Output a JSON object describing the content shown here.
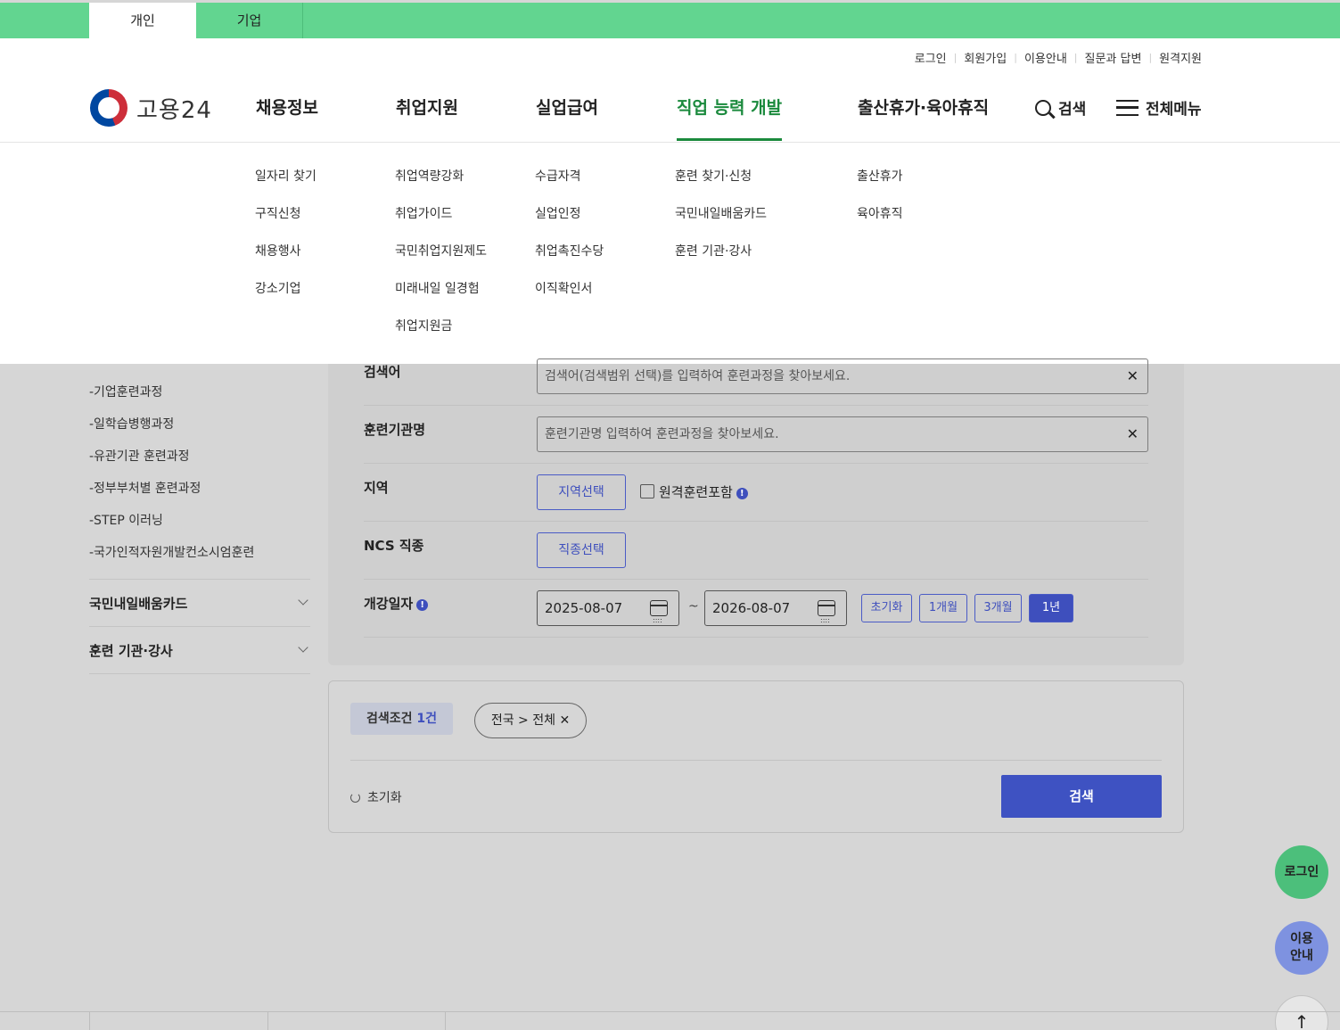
{
  "top_tabs": {
    "personal": "개인",
    "business": "기업"
  },
  "util_menu": [
    "로그인",
    "회원가입",
    "이용안내",
    "질문과 답변",
    "원격지원"
  ],
  "logo": {
    "text": "고용24"
  },
  "gnb": [
    "채용정보",
    "취업지원",
    "실업급여",
    "직업 능력 개발",
    "출산휴가·육아휴직"
  ],
  "header_search": "검색",
  "header_menu": "전체메뉴",
  "submenu": {
    "col1": [
      "일자리 찾기",
      "구직신청",
      "채용행사",
      "강소기업"
    ],
    "col2": [
      "취업역량강화",
      "취업가이드",
      "국민취업지원제도",
      "미래내일 일경험",
      "취업지원금"
    ],
    "col3": [
      "수급자격",
      "실업인정",
      "취업촉진수당",
      "이직확인서"
    ],
    "col4": [
      "훈련 찾기·신청",
      "국민내일배움카드",
      "훈련 기관·강사"
    ],
    "col5": [
      "출산휴가",
      "육아휴직"
    ]
  },
  "sidebar": {
    "subitems": [
      "-기업훈련과정",
      "-일학습병행과정",
      "-유관기관 훈련과정",
      "-정부부처별 훈련과정",
      "-STEP 이러닝",
      "-국가인적자원개발컨소시엄훈련"
    ],
    "sections": [
      "국민내일배움카드",
      "훈련 기관·강사"
    ]
  },
  "form": {
    "keyword_label": "검색어",
    "keyword_placeholder": "검색어(검색범위 선택)를 입력하여 훈련과정을 찾아보세요.",
    "institute_label": "훈련기관명",
    "institute_placeholder": "훈련기관명 입력하여 훈련과정을 찾아보세요.",
    "region_label": "지역",
    "region_button": "지역선택",
    "remote_label": "원격훈련포함",
    "ncs_label": "NCS 직종",
    "ncs_button": "직종선택",
    "date_label": "개강일자",
    "start_date": "2025-08-07",
    "end_date": "2026-08-07",
    "tilde": "~",
    "period_buttons": [
      "초기화",
      "1개월",
      "3개월",
      "1년"
    ]
  },
  "result": {
    "cond_label": "검색조건",
    "cond_count": "1건",
    "chip": "전국 > 전체",
    "reset": "초기화",
    "search": "검색"
  },
  "floating": {
    "login": "로그인",
    "guide_line1": "이용",
    "guide_line2": "안내",
    "top": "↑"
  },
  "colors": {
    "green": "#62d590",
    "active_nav": "#1b8a3d",
    "primary": "#3e52c2"
  }
}
